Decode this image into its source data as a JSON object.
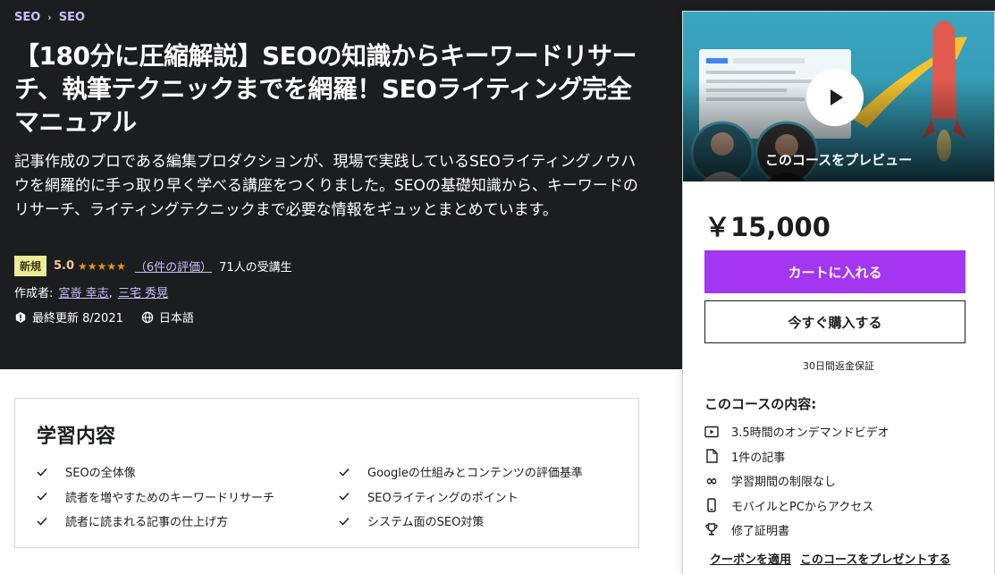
{
  "breadcrumb": [
    "SEO",
    "SEO"
  ],
  "course": {
    "title": "【180分に圧縮解説】SEOの知識からキーワードリサーチ、執筆テクニックまでを網羅！SEOライティング完全マニュアル",
    "subtitle": "記事作成のプロである編集プロダクションが、現場で実践しているSEOライティングノウハウを網羅的に手っ取り早く学べる講座をつくりました。SEOの基礎知識から、キーワードのリサーチ、ライティングテクニックまで必要な情報をギュッとまとめています。",
    "badge": "新規",
    "rating": "5.0",
    "stars": "★★★★★",
    "rating_count": "（6件の評価）",
    "students": "71人の受講生",
    "authors_label": "作成者:",
    "authors": [
      "宮嵜 幸志",
      "三宅 秀晃"
    ],
    "last_updated": "最終更新 8/2021",
    "language": "日本語"
  },
  "card": {
    "preview_label": "このコースをプレビュー",
    "price": "￥15,000",
    "cart_button": "カートに入れる",
    "buy_button": "今すぐ購入する",
    "guarantee": "30日間返金保証",
    "includes_title": "このコースの内容:",
    "includes": [
      {
        "icon": "video-icon",
        "label": "3.5時間のオンデマンドビデオ"
      },
      {
        "icon": "file-icon",
        "label": "1件の記事"
      },
      {
        "icon": "infinity-icon",
        "label": "学習期間の制限なし"
      },
      {
        "icon": "mobile-icon",
        "label": "モバイルとPCからアクセス"
      },
      {
        "icon": "trophy-icon",
        "label": "修了証明書"
      }
    ],
    "coupon_link": "クーポンを適用",
    "gift_link": "このコースをプレゼントする"
  },
  "learn": {
    "title": "学習内容",
    "items": [
      "SEOの全体像",
      "Googleの仕組みとコンテンツの評価基準",
      "読者を増やすためのキーワードリサーチ",
      "SEOライティングのポイント",
      "読者に読まれる記事の仕上げ方",
      "システム面のSEO対策"
    ]
  },
  "colors": {
    "hero_bg": "#1c1d1f",
    "accent_purple": "#a435f0",
    "link_purple": "#cec0fc",
    "star_orange": "#e59819",
    "badge_bg": "#eceb98"
  }
}
